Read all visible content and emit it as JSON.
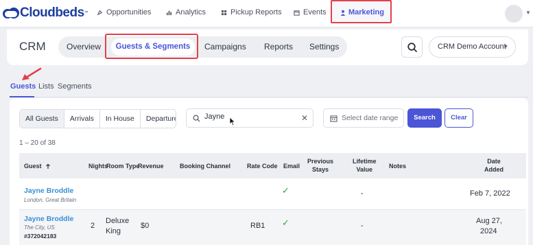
{
  "brand": {
    "name": "Cloudbeds",
    "tm": "™"
  },
  "topnav": {
    "items": [
      {
        "label": "Opportunities",
        "icon": "rocket-icon"
      },
      {
        "label": "Analytics",
        "icon": "bar-chart-icon"
      },
      {
        "label": "Pickup Reports",
        "icon": "grid-icon"
      },
      {
        "label": "Events",
        "icon": "calendar-icon"
      },
      {
        "label": "Marketing",
        "icon": "user-icon"
      }
    ]
  },
  "crm": {
    "title": "CRM",
    "tabs": [
      "Overview",
      "Guests & Segments",
      "Campaigns",
      "Reports",
      "Settings"
    ],
    "account": "CRM Demo Account"
  },
  "subtabs": [
    "Guests",
    "Lists",
    "Segments"
  ],
  "filters": [
    "All Guests",
    "Arrivals",
    "In House",
    "Departures"
  ],
  "search": {
    "value": "Jayne",
    "placeholder": "Search"
  },
  "date_range": {
    "placeholder": "Select date range"
  },
  "buttons": {
    "search": "Search",
    "clear": "Clear"
  },
  "count": "1 – 20 of 38",
  "table": {
    "headers": {
      "guest": "Guest",
      "nights": "Nights",
      "room_type": "Room Type",
      "revenue": "Revenue",
      "booking_channel": "Booking Channel",
      "rate_code": "Rate Code",
      "email": "Email",
      "previous_stays_1": "Previous",
      "previous_stays_2": "Stays",
      "lifetime_value_1": "Lifetime",
      "lifetime_value_2": "Value",
      "notes": "Notes",
      "date_added_1": "Date",
      "date_added_2": "Added"
    },
    "rows": [
      {
        "name": "Jayne Broddle",
        "location": "London, Great Britain",
        "id": "",
        "nights": "",
        "room_type_1": "",
        "room_type_2": "",
        "revenue": "",
        "booking_channel": "",
        "rate_code": "",
        "email": "✓",
        "previous_stays": "",
        "lifetime_value": "-",
        "notes": "",
        "date_added_1": "Feb 7, 2022",
        "date_added_2": ""
      },
      {
        "name": "Jayne Broddle",
        "location": "The City, US",
        "id": "#372042183",
        "nights": "2",
        "room_type_1": "Deluxe",
        "room_type_2": "King",
        "revenue": "$0",
        "booking_channel": "",
        "rate_code": "RB1",
        "email": "✓",
        "previous_stays": "",
        "lifetime_value": "-",
        "notes": "",
        "date_added_1": "Aug 27,",
        "date_added_2": "2024"
      }
    ]
  },
  "colors": {
    "accent": "#4b55d6",
    "link": "#3a8fd6",
    "highlight": "#e0414a",
    "check": "#2fa24a"
  }
}
